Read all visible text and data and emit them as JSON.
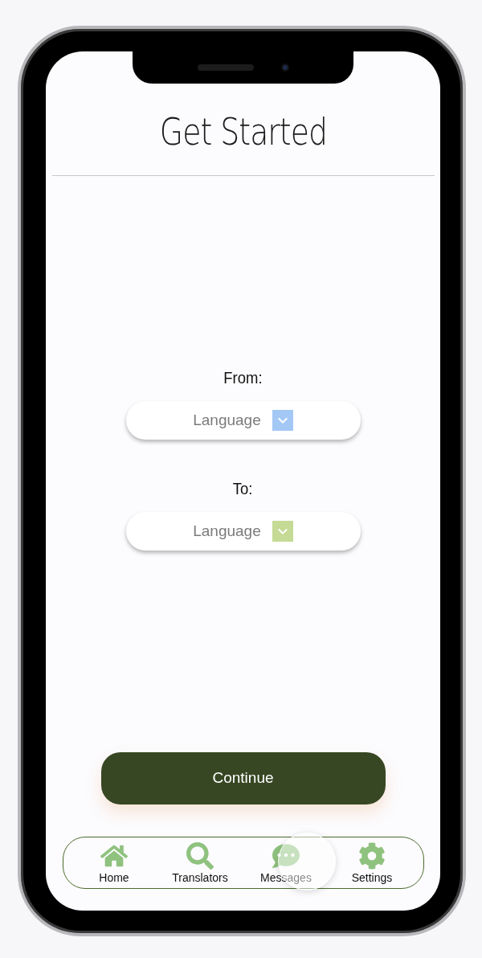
{
  "title": "Get Started",
  "fields": [
    {
      "label": "From:",
      "placeholder": "Language",
      "color": "#a3c8f5"
    },
    {
      "label": "To:",
      "placeholder": "Language",
      "color": "#c5da95"
    }
  ],
  "continue_button": "Continue",
  "nav": [
    {
      "kind": "home",
      "label": "Home"
    },
    {
      "kind": "search",
      "label": "Translators"
    },
    {
      "kind": "messages",
      "label": "Messages"
    },
    {
      "kind": "settings",
      "label": "Settings"
    }
  ]
}
